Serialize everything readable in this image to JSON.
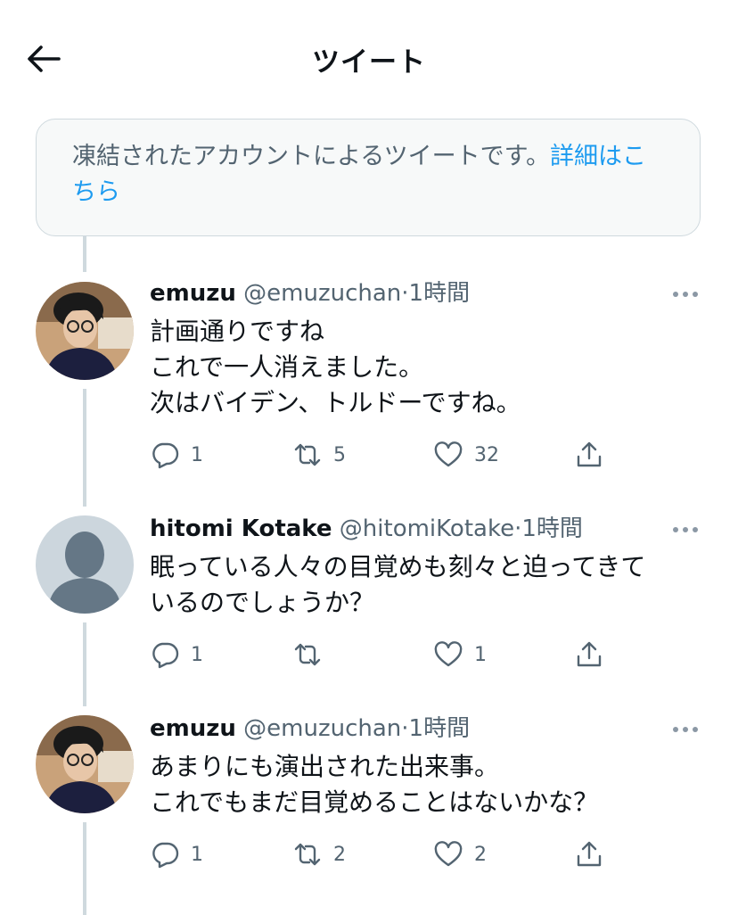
{
  "header": {
    "title": "ツイート"
  },
  "notice": {
    "text": "凍結されたアカウントによるツイートです。",
    "link": "詳細はこちら"
  },
  "tweets": [
    {
      "name": "emuzu",
      "handle": "@emuzuchan",
      "dot": "·",
      "time": "1時間",
      "lines": [
        "計画通りですね",
        "これで一人消えました。",
        "次はバイデン、トルドーですね。"
      ],
      "replies": "1",
      "retweets": "5",
      "likes": "32"
    },
    {
      "name": "hitomi Kotake",
      "handle": "@hitomiKotake",
      "dot": "·",
      "time": "1時間",
      "lines": [
        "眠っている人々の目覚めも刻々と迫ってきて",
        "いるのでしょうか？"
      ],
      "replies": "1",
      "retweets": "",
      "likes": "1"
    },
    {
      "name": "emuzu",
      "handle": "@emuzuchan",
      "dot": "·",
      "time": "1時間",
      "lines": [
        "あまりにも演出された出来事。",
        "これでもまだ目覚めることはないかな？"
      ],
      "replies": "1",
      "retweets": "2",
      "likes": "2"
    }
  ],
  "icons": {
    "back": "arrow-left-icon",
    "more": "more-horizontal-icon",
    "reply": "comment-icon",
    "retweet": "retweet-icon",
    "like": "heart-icon",
    "share": "share-icon"
  },
  "colors": {
    "link": "#1d9bf0",
    "muted": "#536471",
    "line": "#cfd9de"
  }
}
